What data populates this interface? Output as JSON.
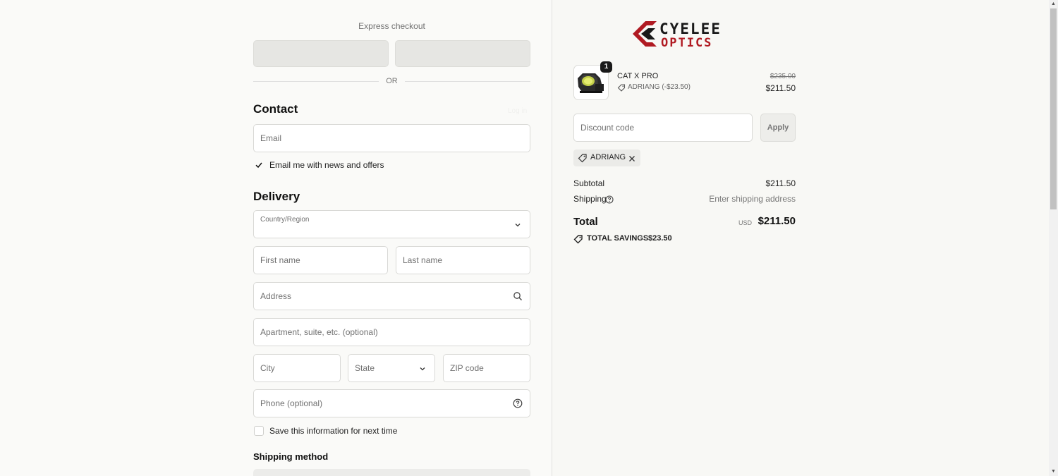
{
  "express": {
    "title": "Express checkout",
    "or_label": "OR"
  },
  "contact": {
    "heading": "Contact",
    "email_placeholder": "Email",
    "news_label": "Email me with news and offers",
    "news_checked": true
  },
  "delivery": {
    "heading": "Delivery",
    "country_label": "Country/Region",
    "country_value": "",
    "first_name_placeholder": "First name",
    "last_name_placeholder": "Last name",
    "address_placeholder": "Address",
    "apartment_placeholder": "Apartment, suite, etc. (optional)",
    "city_placeholder": "City",
    "state_placeholder": "State",
    "zip_placeholder": "ZIP code",
    "phone_placeholder": "Phone (optional)",
    "save_info_label": "Save this information for next time",
    "save_info_checked": false
  },
  "shipping_method": {
    "heading": "Shipping method"
  },
  "brand": {
    "logo_line1": "CYELEE",
    "logo_line2": "OPTICS",
    "logo_color_dark": "#1a1a1a",
    "logo_color_red": "#b01a22"
  },
  "order": {
    "items": [
      {
        "name": "CAT X PRO",
        "quantity": "1",
        "discount_label": "ADRIANG (-$23.50)",
        "original_price": "$235.00",
        "price": "$211.50"
      }
    ],
    "discount_placeholder": "Discount code",
    "apply_label": "Apply",
    "applied_code": "ADRIANG",
    "subtotal_label": "Subtotal",
    "subtotal_value": "$211.50",
    "shipping_label": "Shipping",
    "shipping_value": "Enter shipping address",
    "total_label": "Total",
    "currency": "USD",
    "total_value": "$211.50",
    "savings_label": "TOTAL SAVINGS",
    "savings_value": "$23.50"
  }
}
